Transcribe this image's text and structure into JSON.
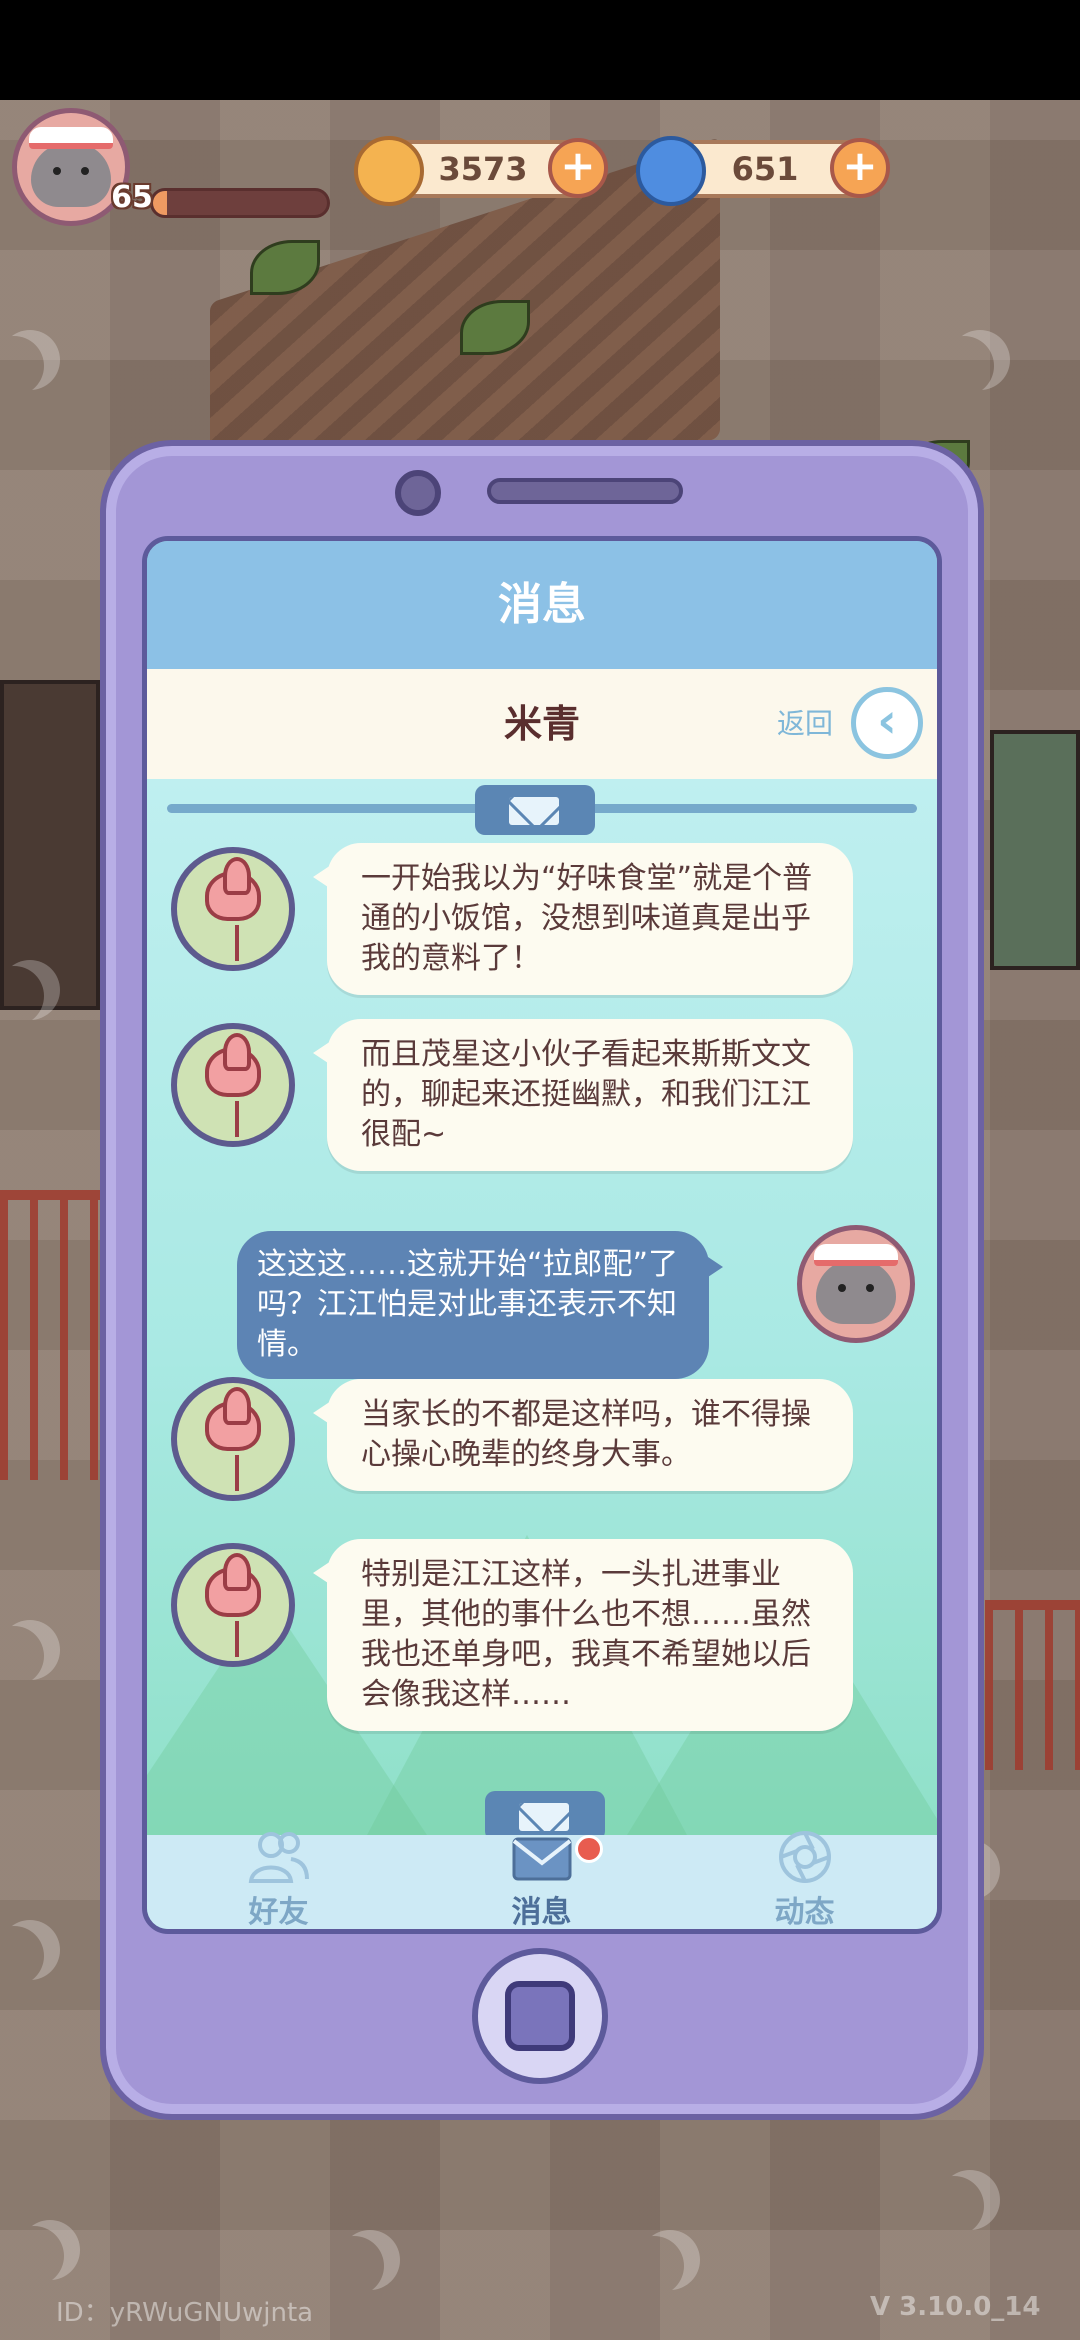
{
  "hud": {
    "level": "65",
    "xp_fraction": 0.08,
    "gold": "3573",
    "gems": "651"
  },
  "phone": {
    "title": "消息",
    "contact_name": "米青",
    "back_label": "返回",
    "messages": [
      {
        "sender": "contact",
        "text": "一开始我以为“好味食堂”就是个普通的小饭馆，没想到味道真是出乎我的意料了！"
      },
      {
        "sender": "contact",
        "text": "而且茂星这小伙子看起来斯斯文文的，聊起来还挺幽默，和我们江江很配~"
      },
      {
        "sender": "self",
        "text": "这这这……这就开始“拉郎配”了吗？江江怕是对此事还表示不知情。"
      },
      {
        "sender": "contact",
        "text": "当家长的不都是这样吗，谁不得操心操心晚辈的终身大事。"
      },
      {
        "sender": "contact",
        "text": "特别是江江这样，一头扎进事业里，其他的事什么也不想……虽然我也还单身吧，我真不希望她以后会像我这样……"
      }
    ],
    "tabs": [
      {
        "label": "好友",
        "icon": "friends-icon"
      },
      {
        "label": "消息",
        "icon": "mail-icon"
      },
      {
        "label": "动态",
        "icon": "moments-icon"
      }
    ]
  },
  "footer": {
    "user_id": "ID：yRWuGNUwjnta",
    "version": "V 3.10.0_14"
  },
  "colors": {
    "phone_body": "#a396d6",
    "title_bar": "#8cc1e6",
    "bubble_self": "#5d84b4",
    "bubble_contact": "#fdfbf0"
  }
}
